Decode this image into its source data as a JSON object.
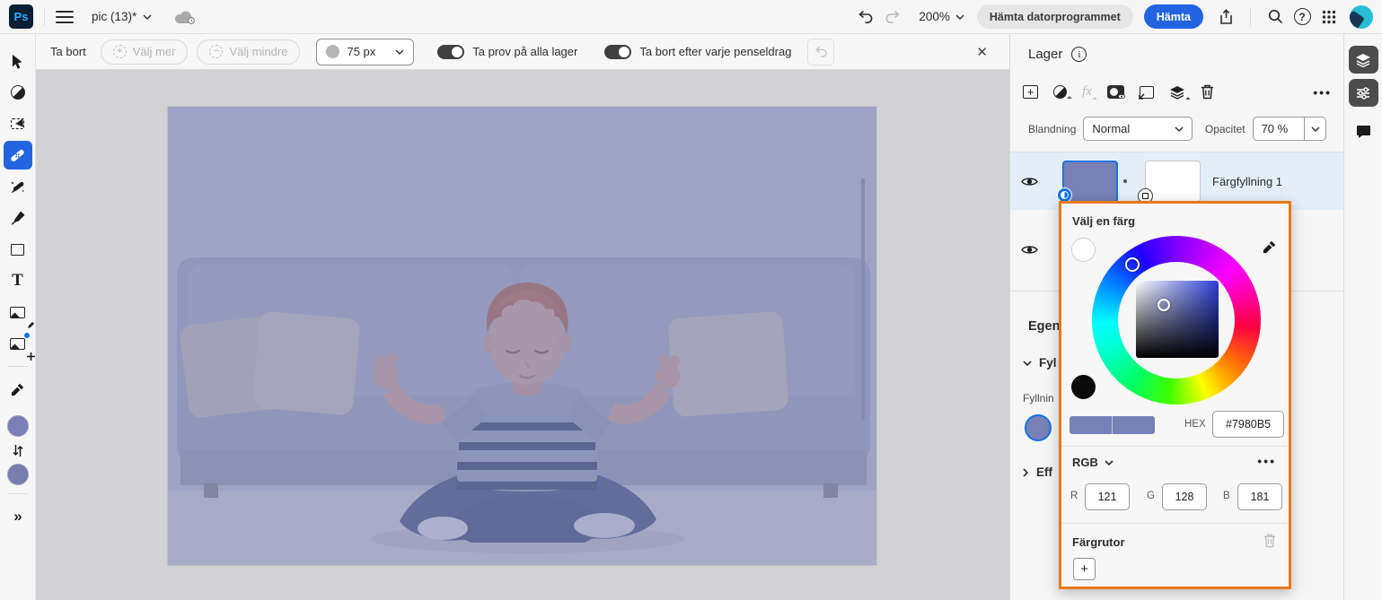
{
  "topbar": {
    "logo": "Ps",
    "doc_title": "pic (13)*",
    "zoom_level": "200%",
    "get_desktop_label": "Hämta datorprogrammet",
    "get_label": "Hämta"
  },
  "options_bar": {
    "tool_name": "Ta bort",
    "select_more": "Välj mer",
    "select_less": "Välj mindre",
    "brush_size": "75 px",
    "toggle_sample": "Ta prov på alla lager",
    "toggle_remove": "Ta bort efter varje penseldrag",
    "close": "✕"
  },
  "layers_panel": {
    "title": "Lager",
    "fx_label": "fx",
    "blend_label": "Blandning",
    "blend_value": "Normal",
    "opacity_label": "Opacitet",
    "opacity_value": "70 %",
    "layer_name": "Färgfyllning 1"
  },
  "properties_panel": {
    "title_fragment": "Egens",
    "fill_section_fragment": "Fyl",
    "fill_label_fragment": "Fyllnin",
    "effects_fragment": "Eff"
  },
  "color_picker": {
    "title": "Välj en färg",
    "hex_label": "HEX",
    "hex_value": "#7980B5",
    "mode_label": "RGB",
    "r_label": "R",
    "r_value": "121",
    "g_label": "G",
    "g_value": "128",
    "b_label": "B",
    "b_value": "181",
    "swatches_title": "Färgrutor",
    "add_swatch_label": "+"
  },
  "tools": {
    "type_glyph": "T",
    "more_glyph": "»"
  },
  "colors": {
    "accent": "#2264e0",
    "fill": "#7980b5",
    "picker_border": "#e87a17",
    "toggle_on": "#3f3f3f",
    "selected_row": "#e4eef9",
    "avatar": "#27bdd6"
  }
}
